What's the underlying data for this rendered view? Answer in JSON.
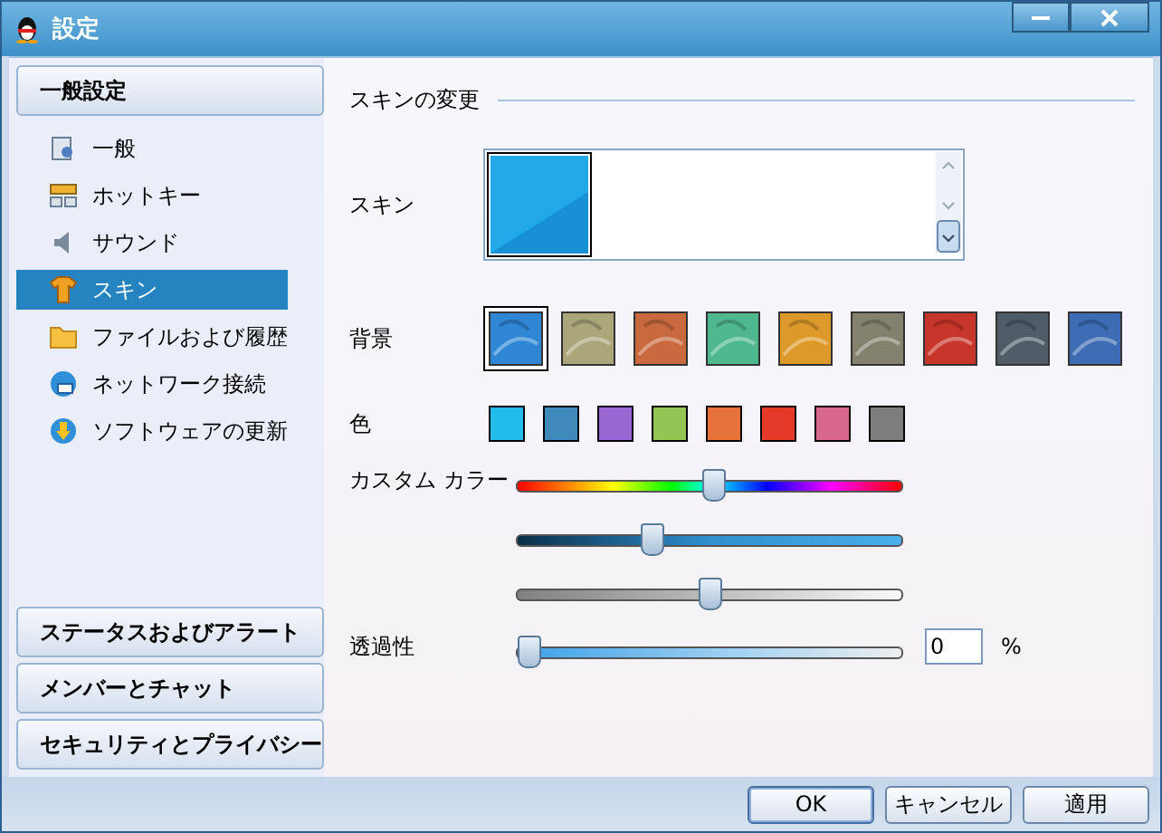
{
  "window": {
    "title": "設定"
  },
  "sidebar": {
    "header": "一般設定",
    "items": [
      {
        "label": "一般",
        "selected": false
      },
      {
        "label": "ホットキー",
        "selected": false
      },
      {
        "label": "サウンド",
        "selected": false
      },
      {
        "label": "スキン",
        "selected": true
      },
      {
        "label": "ファイルおよび履歴",
        "selected": false
      },
      {
        "label": "ネットワーク接続",
        "selected": false
      },
      {
        "label": "ソフトウェアの更新",
        "selected": false
      }
    ],
    "sections": [
      "ステータスおよびアラート",
      "メンバーとチャット",
      "セキュリティとプライバシー"
    ]
  },
  "content": {
    "heading": "スキンの変更",
    "skin_label": "スキン",
    "background_label": "背景",
    "backgrounds": [
      {
        "color": "#2f86d4",
        "selected": true
      },
      {
        "color": "#aba67a",
        "selected": false
      },
      {
        "color": "#c8693e",
        "selected": false
      },
      {
        "color": "#4fb88e",
        "selected": false
      },
      {
        "color": "#dd9a2a",
        "selected": false
      },
      {
        "color": "#84816f",
        "selected": false
      },
      {
        "color": "#c8352a",
        "selected": false
      },
      {
        "color": "#4f5b67",
        "selected": false
      },
      {
        "color": "#3d6cb4",
        "selected": false
      }
    ],
    "color_label": "色",
    "colors": [
      {
        "color": "#22bbea"
      },
      {
        "color": "#3f88ba"
      },
      {
        "color": "#9867d2"
      },
      {
        "color": "#94c454"
      },
      {
        "color": "#e8733a"
      },
      {
        "color": "#e33a2a"
      },
      {
        "color": "#d86790"
      },
      {
        "color": "#7c7e7c"
      }
    ],
    "custom_color_label": "カスタム カラー",
    "sliders": [
      {
        "kind": "hue",
        "level": 0.51
      },
      {
        "kind": "shade",
        "level": 0.34
      },
      {
        "kind": "gray",
        "level": 0.5
      }
    ],
    "transparency": {
      "label": "透過性",
      "level": 0,
      "value": "0",
      "unit": "%"
    }
  },
  "buttons": [
    "OK",
    "キャンセル",
    "適用"
  ]
}
